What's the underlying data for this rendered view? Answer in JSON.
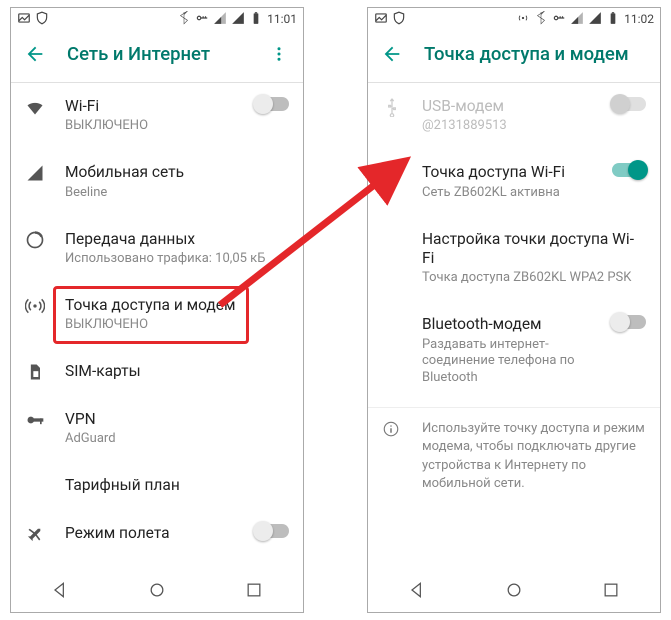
{
  "left": {
    "status": {
      "time": "11:01"
    },
    "title": "Сеть и Интернет",
    "items": [
      {
        "primary": "Wi-Fi",
        "secondary": "ВЫКЛЮЧЕНО",
        "icon": "wifi",
        "toggle": "off"
      },
      {
        "primary": "Мобильная сеть",
        "secondary": "Beeline",
        "icon": "signal"
      },
      {
        "primary": "Передача данных",
        "secondary": "Использовано трафика: 10,05 кБ",
        "icon": "data"
      },
      {
        "primary": "Точка доступа и модем",
        "secondary": "ВЫКЛЮЧЕНО",
        "icon": "hotspot",
        "highlight": true
      },
      {
        "primary": "SIM-карты",
        "secondary": "",
        "icon": "sim"
      },
      {
        "primary": "VPN",
        "secondary": "AdGuard",
        "icon": "vpn"
      },
      {
        "primary": "Тарифный план",
        "secondary": "",
        "icon": ""
      },
      {
        "primary": "Режим полета",
        "secondary": "",
        "icon": "airplane",
        "toggle": "off"
      }
    ]
  },
  "right": {
    "status": {
      "time": "11:02"
    },
    "title": "Точка доступа и модем",
    "items": [
      {
        "primary": "USB-модем",
        "secondary": "@2131889513",
        "icon": "usb",
        "toggle": "disabled",
        "disabled": true
      },
      {
        "primary": "Точка доступа Wi-Fi",
        "secondary": "Сеть ZB602KL активна",
        "icon": "",
        "toggle": "on"
      },
      {
        "primary": "Настройка точки доступа Wi-Fi",
        "secondary": "Точка доступа ZB602KL WPA2 PSK",
        "icon": ""
      },
      {
        "primary": "Bluetooth-модем",
        "secondary": "Раздавать интернет-соединение телефона по Bluetooth",
        "icon": "",
        "toggle": "off"
      }
    ],
    "note": "Используйте точку доступа и режим модема, чтобы подключать другие устройства к Интернету по мобильной сети."
  }
}
